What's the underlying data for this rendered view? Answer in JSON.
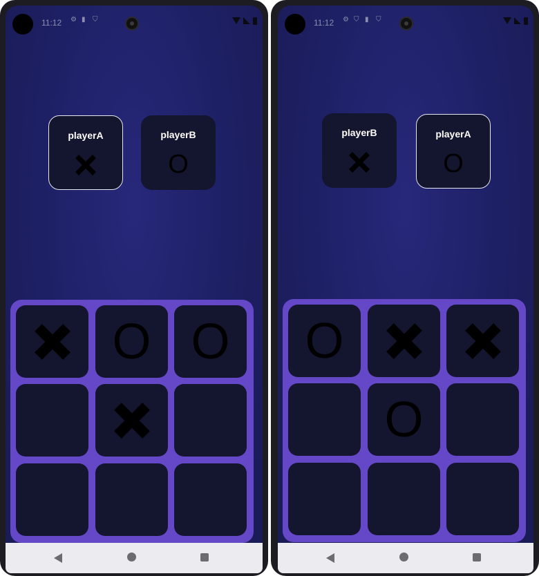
{
  "colors": {
    "background": "#1f2168",
    "card": "#14152e",
    "board": "#6548c7",
    "active_border": "#e8e8f0",
    "nav_bar": "#ecebf0"
  },
  "left_phone": {
    "status": {
      "time": "11:12",
      "icons": [
        "gear-icon",
        "sim-card-icon",
        "shield-icon"
      ],
      "right_icons": [
        "wifi-icon",
        "signal-icon",
        "battery-icon"
      ]
    },
    "players": [
      {
        "name": "playerA",
        "mark": "X",
        "active": true
      },
      {
        "name": "playerB",
        "mark": "O",
        "active": false
      }
    ],
    "board": [
      "X",
      "O",
      "O",
      "",
      "X",
      "",
      "",
      "",
      ""
    ],
    "nav": [
      "back-icon",
      "home-icon",
      "recents-icon"
    ]
  },
  "right_phone": {
    "status": {
      "time": "11:12",
      "icons": [
        "gear-icon",
        "shield-icon",
        "sim-card-icon",
        "shield-icon"
      ],
      "right_icons": [
        "wifi-icon",
        "signal-icon",
        "battery-icon"
      ]
    },
    "players": [
      {
        "name": "playerB",
        "mark": "X",
        "active": false
      },
      {
        "name": "playerA",
        "mark": "O",
        "active": true
      }
    ],
    "board": [
      "O",
      "X",
      "X",
      "",
      "O",
      "",
      "",
      "",
      ""
    ],
    "nav": [
      "back-icon",
      "home-icon",
      "recents-icon"
    ]
  }
}
